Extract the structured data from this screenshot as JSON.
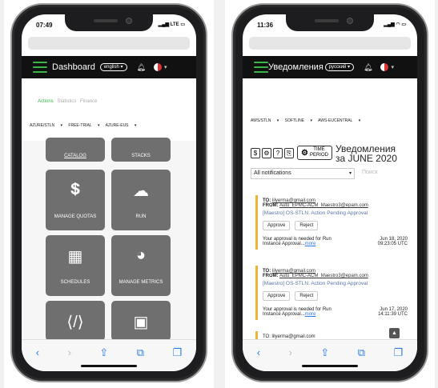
{
  "left": {
    "time": "07:49",
    "status_signal": "LTE",
    "app_title": "Dashboard",
    "language": "english",
    "tabs": [
      "Actions",
      "Statistics",
      "Finance"
    ],
    "filters": [
      "AZURE/STLN",
      "FREE-TRIAL",
      "AZURE-EUS"
    ],
    "tiles": [
      {
        "label": "CATALOG",
        "icon": "catalog-icon"
      },
      {
        "label": "STACKS",
        "icon": "stacks-icon"
      },
      {
        "label": "MANAGE QUOTAS",
        "icon": "money-stack-icon"
      },
      {
        "label": "RUN",
        "icon": "cloud-add-icon"
      },
      {
        "label": "SCHEDULES",
        "icon": "calendar-icon"
      },
      {
        "label": "MANAGE METRICS",
        "icon": "pie-chart-icon"
      },
      {
        "label": "",
        "icon": "code-file-icon"
      },
      {
        "label": "",
        "icon": "cubes-icon"
      }
    ]
  },
  "right": {
    "time": "11:36",
    "app_title": "Уведомления",
    "language": "русский",
    "filters": [
      "AWS/STLN",
      "SOFTLINE",
      "AWS-EUCENTRAL"
    ],
    "time_period_line1": "TIME",
    "time_period_line2": "PERIOD",
    "title_line1": "Уведомления",
    "title_line2": "за JUNE 2020",
    "select_value": "All notifications",
    "search_placeholder": "Поиск",
    "notifications": [
      {
        "to_label": "TO:",
        "to": "lilyerma@gmail.com",
        "from_label": "FROM:",
        "from": "Auto_EPMC-ACM_Maestro3@epam.com",
        "subject": "[Maestro] OS-STLN. Action Pending Approval",
        "approve": "Approve",
        "reject": "Reject",
        "message": "Your approval is needed for Run Instance Approval...",
        "more": "more",
        "date": "Jun 18, 2020",
        "time": "09:23:05 UTC"
      },
      {
        "to_label": "TO:",
        "to": "lilyerma@gmail.com",
        "from_label": "FROM:",
        "from": "Auto_EPMC-ACM_Maestro3@epam.com",
        "subject": "[Maestro] OS-STLN. Action Pending Approval",
        "approve": "Approve",
        "reject": "Reject",
        "message": "Your approval is needed for Run Instance Approval...",
        "more": "more",
        "date": "Jun 17, 2020",
        "time": "14:11:39 UTC"
      }
    ],
    "partial_to": "TO: lilyerma@gmail.com"
  },
  "colors": {
    "accent": "#39b54a",
    "tile": "#6f6f6f",
    "notif_border": "#f2b233",
    "link": "#2b7de9"
  }
}
